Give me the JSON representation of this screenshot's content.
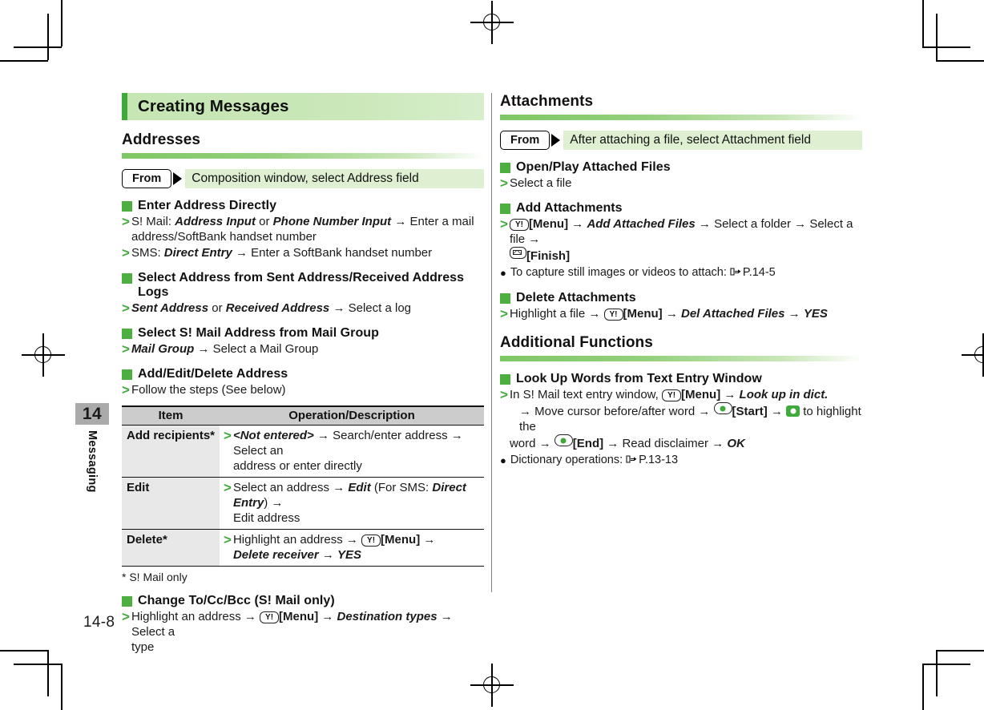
{
  "document": {
    "chapter_number": "14",
    "chapter_label": "Messaging",
    "folio": "14-8"
  },
  "left_column": {
    "banner_title": "Creating Messages",
    "section": {
      "heading": "Addresses",
      "from_label": "From",
      "from_text": "Composition window, select Address field",
      "blocks": [
        {
          "heading": "Enter Address Directly",
          "steps": [
            "S! Mail: Address Input or Phone Number Input → Enter a mail address/SoftBank handset number",
            "SMS: Direct Entry → Enter a SoftBank handset number"
          ]
        },
        {
          "heading": "Select Address from Sent Address/Received Address Logs",
          "steps": [
            "Sent Address or Received Address → Select a log"
          ]
        },
        {
          "heading": "Select S! Mail Address from Mail Group",
          "steps": [
            "Mail Group → Select a Mail Group"
          ]
        },
        {
          "heading": "Add/Edit/Delete Address",
          "steps": [
            "Follow the steps (See below)"
          ]
        }
      ],
      "table": {
        "headers": [
          "Item",
          "Operation/Description"
        ],
        "rows": [
          {
            "item": "Add recipients*",
            "desc": "<Not entered> → Search/enter address → Select an address or enter directly"
          },
          {
            "item": "Edit",
            "desc": "Select an address → Edit (For SMS: Direct Entry) → Edit address"
          },
          {
            "item": "Delete*",
            "desc": "Highlight an address → [Y!][Menu] → Delete receiver → YES"
          }
        ],
        "footnote": "* S! Mail only"
      },
      "last_block": {
        "heading": "Change To/Cc/Bcc (S! Mail only)",
        "step": "Highlight an address → [Y!][Menu] → Destination types → Select a type"
      }
    }
  },
  "right_column": {
    "attachments": {
      "heading": "Attachments",
      "from_label": "From",
      "from_text": "After attaching a file, select Attachment field",
      "blocks": [
        {
          "heading": "Open/Play Attached Files",
          "steps": [
            "Select a file"
          ]
        },
        {
          "heading": "Add Attachments",
          "steps": [
            "[Y!][Menu] → Add Attached Files → Select a folder → Select a file → [Mail][Finish]"
          ],
          "bullet": "To capture still images or videos to attach: P.14-5",
          "bullet_ref": "P.14-5"
        },
        {
          "heading": "Delete Attachments",
          "steps": [
            "Highlight a file → [Y!][Menu] → Del Attached Files → YES"
          ]
        }
      ]
    },
    "additional_functions": {
      "heading": "Additional Functions",
      "blocks": [
        {
          "heading": "Look Up Words from Text Entry Window",
          "steps": [
            "In S! Mail text entry window, [Y!][Menu] → Look up in dict. → Move cursor before/after word → [Center][Start] → [Nav] to highlight the word → [Center][End] → Read disclaimer → OK"
          ],
          "bullet": "Dictionary operations: P.13-13",
          "bullet_ref": "P.13-13"
        }
      ]
    }
  },
  "text_fragments": {
    "t_smail_prefix": "S! Mail:",
    "t_address_input": "Address Input",
    "t_or": "or",
    "t_phone_number_input": "Phone Number Input",
    "t_enter_a_mail": "Enter a mail",
    "t_address_sb": "address/SoftBank handset number",
    "t_sms_prefix": "SMS:",
    "t_direct_entry": "Direct Entry",
    "t_enter_sb_number": "Enter a SoftBank handset number",
    "t_sent_address": "Sent Address",
    "t_received_address": "Received Address",
    "t_select_a_log": "Select a log",
    "t_mail_group": "Mail Group",
    "t_select_mail_group": "Select a Mail Group",
    "t_follow_steps": "Follow the steps (See below)",
    "t_not_entered": "<Not entered>",
    "t_search_enter_address": "Search/enter address",
    "t_select_an_address_or": "Select an",
    "t_address_or_enter": "address or enter directly",
    "t_select_an_address": "Select an address",
    "t_edit": "Edit",
    "t_for_sms": "(For SMS:",
    "t_direct_entry_close": ")",
    "t_edit_address": "Edit address",
    "t_highlight_an_address": "Highlight an address",
    "t_menu": "[Menu]",
    "t_delete_receiver": "Delete receiver",
    "t_yes": "YES",
    "t_destination_types": "Destination types",
    "t_select_a": "Select a",
    "t_type": "type",
    "t_select_a_file": "Select a file",
    "t_add_attached_files": "Add Attached Files",
    "t_select_a_folder": "Select a folder",
    "t_select_a_file2": "Select a file",
    "t_finish": "[Finish]",
    "t_capture": "To capture still images or videos to attach:",
    "t_highlight_a_file": "Highlight a file",
    "t_del_attached_files": "Del Attached Files",
    "t_in_smail_text": "In S! Mail text entry window,",
    "t_look_up_in_dict": "Look up in dict.",
    "t_move_cursor": "Move cursor before/after word",
    "t_start": "[Start]",
    "t_to_highlight": "to highlight the",
    "t_word": "word",
    "t_end": "[End]",
    "t_read_disclaimer": "Read disclaimer",
    "t_ok": "OK",
    "t_dict_ops": "Dictionary operations:",
    "t_arrow": "→",
    "t_key_y": "Y!"
  },
  "colors": {
    "accent_green": "#3faa3b",
    "banner_green": "#c6e6b4",
    "band_green": "#dff0d2",
    "table_header_gray": "#cccccc",
    "tab_gray": "#aaaaaa"
  }
}
